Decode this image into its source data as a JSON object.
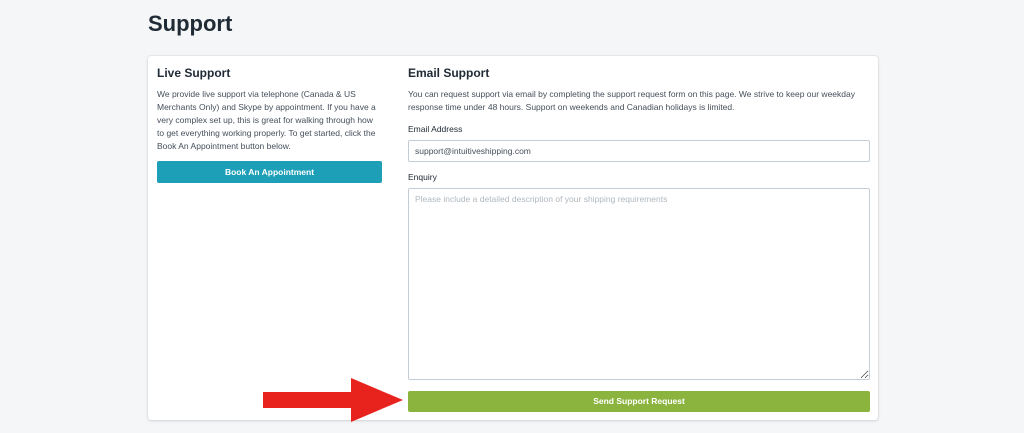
{
  "page": {
    "title": "Support"
  },
  "live_support": {
    "title": "Live Support",
    "description": "We provide live support via telephone (Canada & US Merchants Only) and Skype by appointment. If you have a very complex set up, this is great for walking through how to get everything working properly. To get started, click the Book An Appointment button below.",
    "button_label": "Book An Appointment"
  },
  "email_support": {
    "title": "Email Support",
    "description": "You can request support via email by completing the support request form on this page. We strive to keep our weekday response time under 48 hours. Support on weekends and Canadian holidays is limited.",
    "email_label": "Email Address",
    "email_value": "support@intuitiveshipping.com",
    "enquiry_label": "Enquiry",
    "enquiry_placeholder": "Please include a detailed description of your shipping requirements",
    "submit_label": "Send Support Request"
  },
  "colors": {
    "teal_button": "#1d9fb7",
    "green_button": "#8bb43f",
    "arrow": "#e8231d"
  },
  "icons": {
    "annotation": "red-arrow-right-icon"
  }
}
